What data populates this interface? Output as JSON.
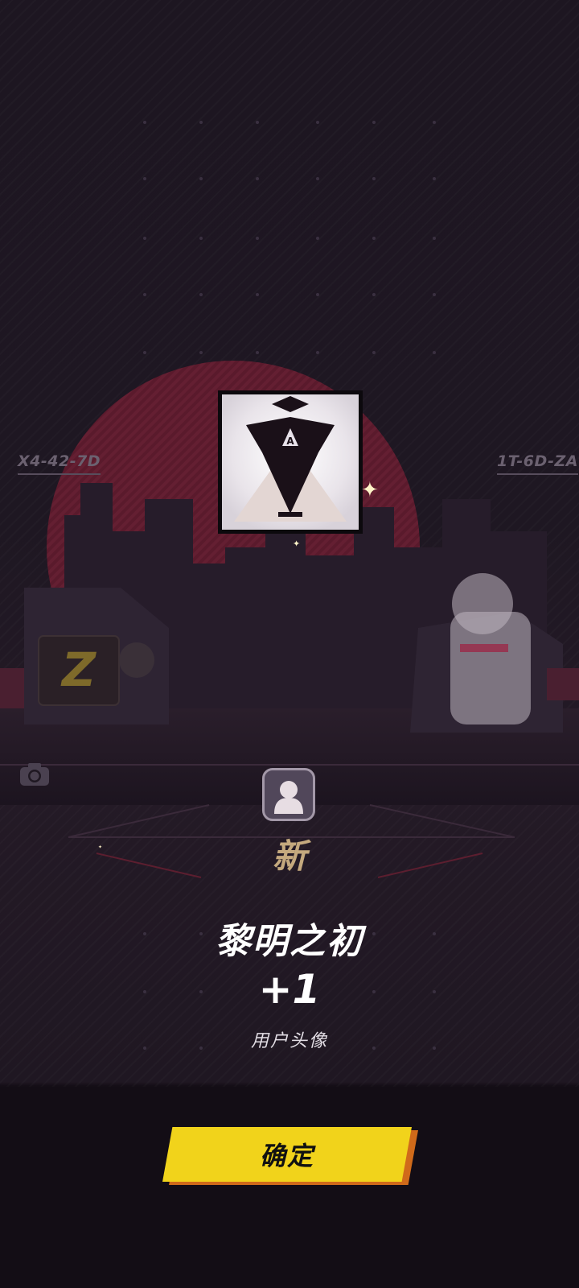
{
  "background": {
    "left_code": "X4-42-7D",
    "right_code": "1T-6D-ZA"
  },
  "reward": {
    "icon": "dawn-avatar-icon",
    "new_tag": "新",
    "name": "黎明之初",
    "count": "+1",
    "type": "用户头像"
  },
  "buttons": {
    "confirm_label": "确定"
  },
  "colors": {
    "accent_yellow": "#f1d31b",
    "accent_orange": "#d06a1a",
    "new_tag_gold": "#c4a97e",
    "moon_red": "#6a1f32"
  }
}
